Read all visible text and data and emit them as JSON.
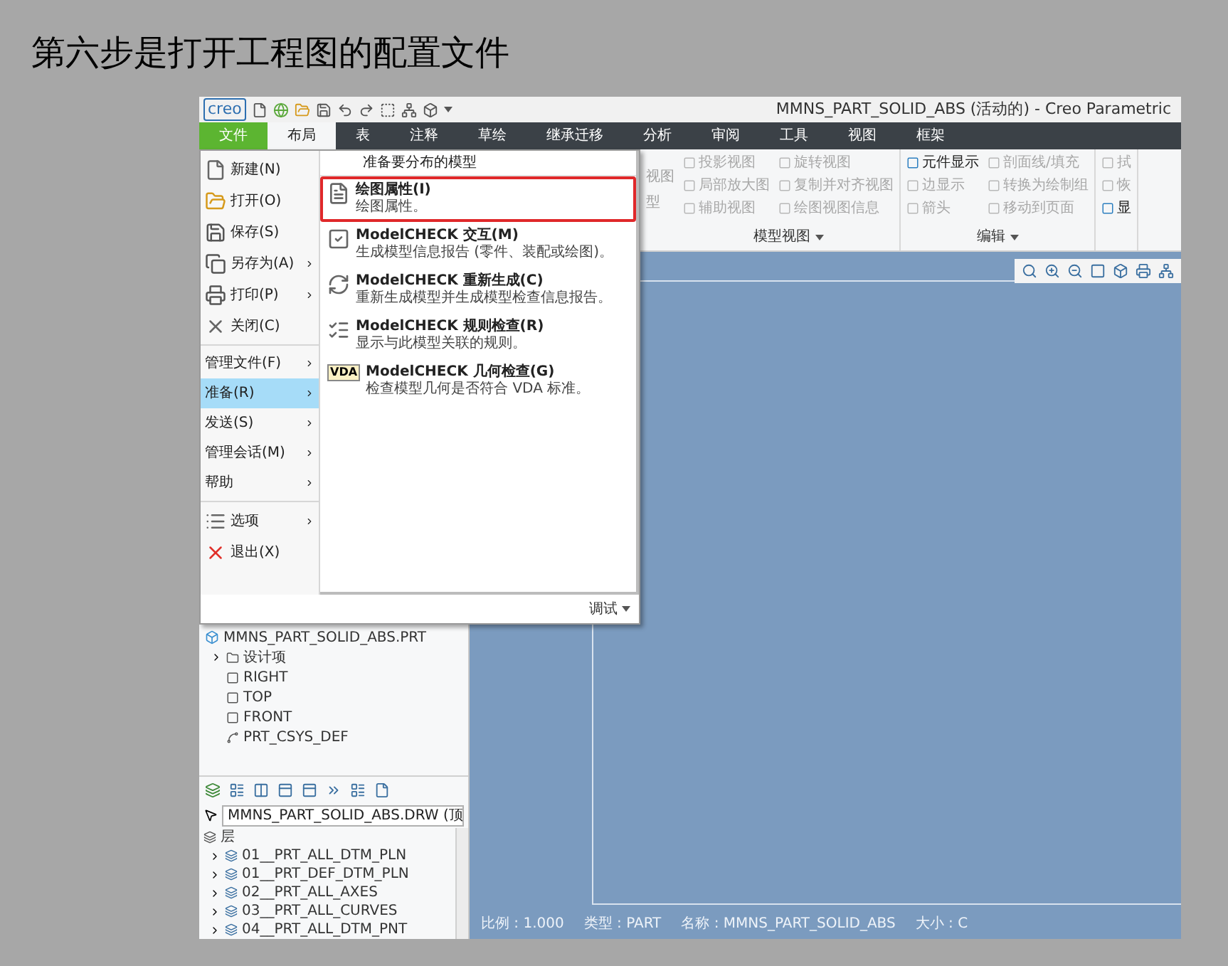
{
  "heading": "第六步是打开工程图的配置文件",
  "window": {
    "logo": "creo",
    "title": "MMNS_PART_SOLID_ABS (活动的) - Creo Parametric"
  },
  "tabs": [
    {
      "label": "文件",
      "kind": "file",
      "selected": false
    },
    {
      "label": "布局",
      "kind": "tab",
      "selected": true
    },
    {
      "label": "表",
      "kind": "tab",
      "selected": false
    },
    {
      "label": "注释",
      "kind": "tab",
      "selected": false
    },
    {
      "label": "草绘",
      "kind": "tab",
      "selected": false
    },
    {
      "label": "继承迁移",
      "kind": "tab",
      "selected": false
    },
    {
      "label": "分析",
      "kind": "tab",
      "selected": false
    },
    {
      "label": "审阅",
      "kind": "tab",
      "selected": false
    },
    {
      "label": "工具",
      "kind": "tab",
      "selected": false
    },
    {
      "label": "视图",
      "kind": "tab",
      "selected": false
    },
    {
      "label": "框架",
      "kind": "tab",
      "selected": false
    }
  ],
  "ribbon": {
    "fragments": [
      "视图",
      "型"
    ],
    "groups": [
      {
        "label": "模型视图",
        "columns": [
          [
            {
              "label": "投影视图",
              "disabled": true
            },
            {
              "label": "局部放大图",
              "disabled": true
            },
            {
              "label": "辅助视图",
              "disabled": true
            }
          ],
          [
            {
              "label": "旋转视图",
              "disabled": true
            },
            {
              "label": "复制并对齐视图",
              "disabled": true
            },
            {
              "label": "绘图视图信息",
              "disabled": true
            }
          ]
        ]
      },
      {
        "label": "编辑",
        "columns": [
          [
            {
              "label": "元件显示",
              "disabled": false
            },
            {
              "label": "边显示",
              "disabled": true
            },
            {
              "label": "箭头",
              "disabled": true
            }
          ],
          [
            {
              "label": "剖面线/填充",
              "disabled": true
            },
            {
              "label": "转换为绘制组",
              "disabled": true
            },
            {
              "label": "移动到页面",
              "disabled": true
            }
          ]
        ]
      },
      {
        "columns": [
          [
            {
              "label": "拭",
              "disabled": true
            },
            {
              "label": "恢",
              "disabled": true
            },
            {
              "label": "显",
              "disabled": false
            }
          ]
        ]
      }
    ]
  },
  "file_menu": {
    "sections": [
      {
        "items": [
          {
            "label": "新建(N)",
            "kind": "large",
            "submenu": false,
            "selected": false
          },
          {
            "label": "打开(O)",
            "kind": "large",
            "submenu": false,
            "selected": false
          },
          {
            "label": "保存(S)",
            "kind": "large",
            "submenu": false,
            "selected": false
          },
          {
            "label": "另存为(A)",
            "kind": "large",
            "submenu": true,
            "selected": false
          },
          {
            "label": "打印(P)",
            "kind": "large",
            "submenu": true,
            "selected": false
          },
          {
            "label": "关闭(C)",
            "kind": "large",
            "submenu": false,
            "selected": false
          }
        ]
      },
      {
        "items": [
          {
            "label": "管理文件(F)",
            "kind": "small",
            "submenu": true,
            "selected": false
          },
          {
            "label": "准备(R)",
            "kind": "small",
            "submenu": true,
            "selected": true
          },
          {
            "label": "发送(S)",
            "kind": "small",
            "submenu": true,
            "selected": false
          },
          {
            "label": "管理会话(M)",
            "kind": "small",
            "submenu": true,
            "selected": false
          },
          {
            "label": "帮助",
            "kind": "small",
            "submenu": true,
            "selected": false
          }
        ]
      },
      {
        "items": [
          {
            "label": "选项",
            "kind": "large",
            "submenu": true,
            "selected": false
          },
          {
            "label": "退出(X)",
            "kind": "large",
            "submenu": false,
            "selected": false
          }
        ]
      }
    ],
    "submenu": {
      "title": "准备要分布的模型",
      "items": [
        {
          "title": "绘图属性(I)",
          "description": "绘图属性。",
          "highlighted": true
        },
        {
          "title": "ModelCHECK 交互(M)",
          "description": "生成模型信息报告 (零件、装配或绘图)。",
          "highlighted": false
        },
        {
          "title": "ModelCHECK 重新生成(C)",
          "description": "重新生成模型并生成模型检查信息报告。",
          "highlighted": false
        },
        {
          "title": "ModelCHECK 规则检查(R)",
          "description": "显示与此模型关联的规则。",
          "highlighted": false
        },
        {
          "title": "ModelCHECK 几何检查(G)",
          "description": "检查模型几何是否符合 VDA 标准。",
          "icon_text": "VDA",
          "highlighted": false
        }
      ]
    },
    "footer": "调试"
  },
  "model_tree": {
    "label": "MMNS_PART_SOLID_ABS.PRT",
    "children": [
      {
        "label": "设计项",
        "kind": "folder",
        "expanded": false
      },
      {
        "label": "RIGHT",
        "kind": "plane"
      },
      {
        "label": "TOP",
        "kind": "plane"
      },
      {
        "label": "FRONT",
        "kind": "plane"
      },
      {
        "label": "PRT_CSYS_DEF",
        "kind": "csys"
      }
    ]
  },
  "layers": {
    "model": "MMNS_PART_SOLID_ABS.DRW (顶",
    "root": {
      "label": "层",
      "children": [
        {
          "label": "01__PRT_ALL_DTM_PLN",
          "expanded": false
        },
        {
          "label": "01__PRT_DEF_DTM_PLN",
          "expanded": false
        },
        {
          "label": "02__PRT_ALL_AXES",
          "expanded": false
        },
        {
          "label": "03__PRT_ALL_CURVES",
          "expanded": false
        },
        {
          "label": "04__PRT_ALL_DTM_PNT",
          "expanded": false
        }
      ]
    }
  },
  "status_bar": [
    "比例 : 1.000",
    "类型 : PART",
    "名称 : MMNS_PART_SOLID_ABS",
    "大小 : C"
  ]
}
